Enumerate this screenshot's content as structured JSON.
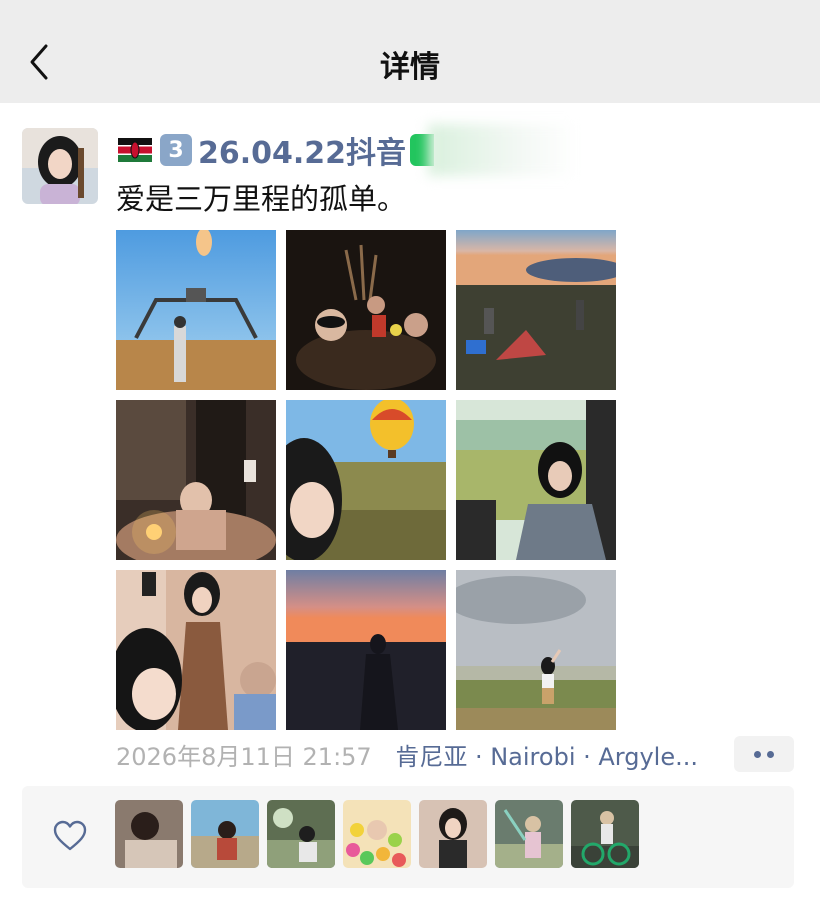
{
  "nav": {
    "title": "详情",
    "back_icon": "chevron-left-icon"
  },
  "post": {
    "badge_number": "3",
    "author": "26.04.22抖音",
    "text": "爱是三万里程的孤单。",
    "date": "2026年8月11日",
    "time": "21:57",
    "location": "肯尼亚 · Nairobi · Argyle..."
  },
  "icons": {
    "flag": "kenya-flag-icon",
    "more": "more-dots-icon",
    "like": "heart-icon"
  },
  "colors": {
    "link_blue": "#576b95",
    "navbar_bg": "#ededed",
    "meta_gray": "#b2b2b2"
  }
}
